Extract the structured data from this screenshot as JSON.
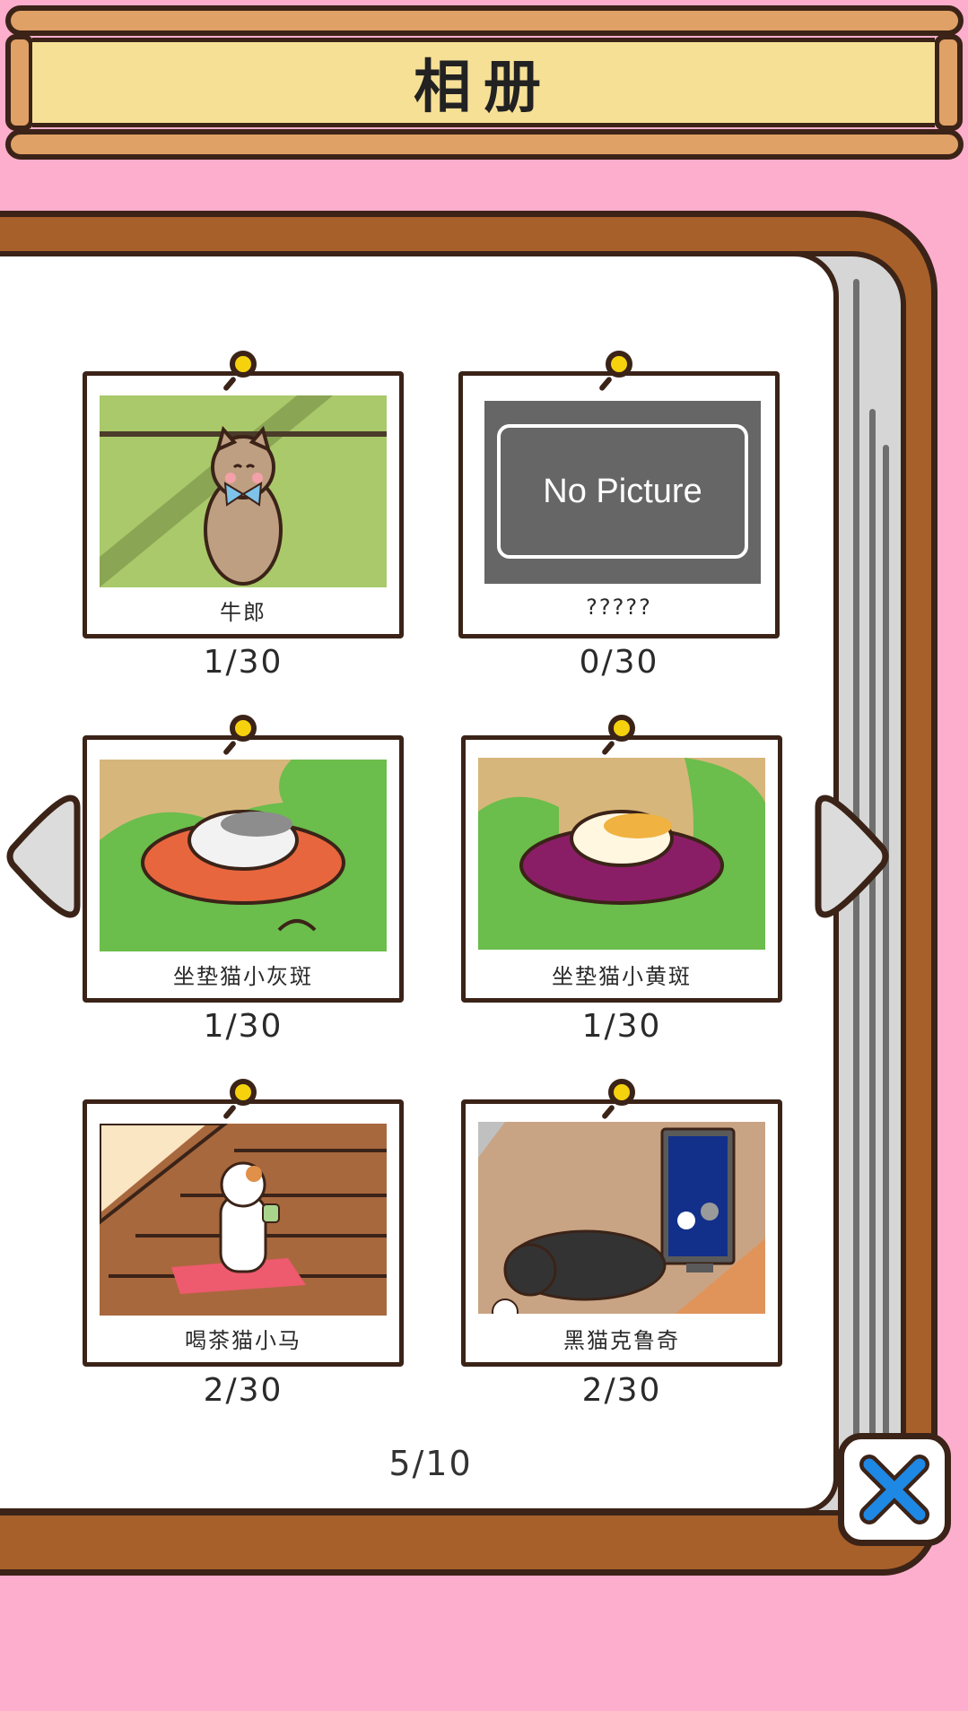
{
  "header": {
    "title": "相册"
  },
  "photos": [
    {
      "name": "牛郎",
      "count": "1/30",
      "scene": "green-room-cat-bow"
    },
    {
      "name": "?????",
      "count": "0/30",
      "placeholder": "No Picture"
    },
    {
      "name": "坐垫猫小灰斑",
      "count": "1/30",
      "scene": "gray-cat-orange-cushion"
    },
    {
      "name": "坐垫猫小黄斑",
      "count": "1/30",
      "scene": "yellow-cat-purple-cushion"
    },
    {
      "name": "喝茶猫小马",
      "count": "2/30",
      "scene": "calico-cat-drinking-tea"
    },
    {
      "name": "黑猫克鲁奇",
      "count": "2/30",
      "scene": "black-cat-tv"
    }
  ],
  "pagination": {
    "current": "5/10"
  },
  "icons": {
    "prev": "triangle-left-icon",
    "next": "triangle-right-icon",
    "close": "close-x-icon",
    "pin": "pushpin-icon"
  },
  "colors": {
    "background": "#fdaecd",
    "wood": "#a8602a",
    "sign_panel": "#f6e096",
    "pin": "#f5d20d",
    "close_x": "#1e88e5"
  }
}
